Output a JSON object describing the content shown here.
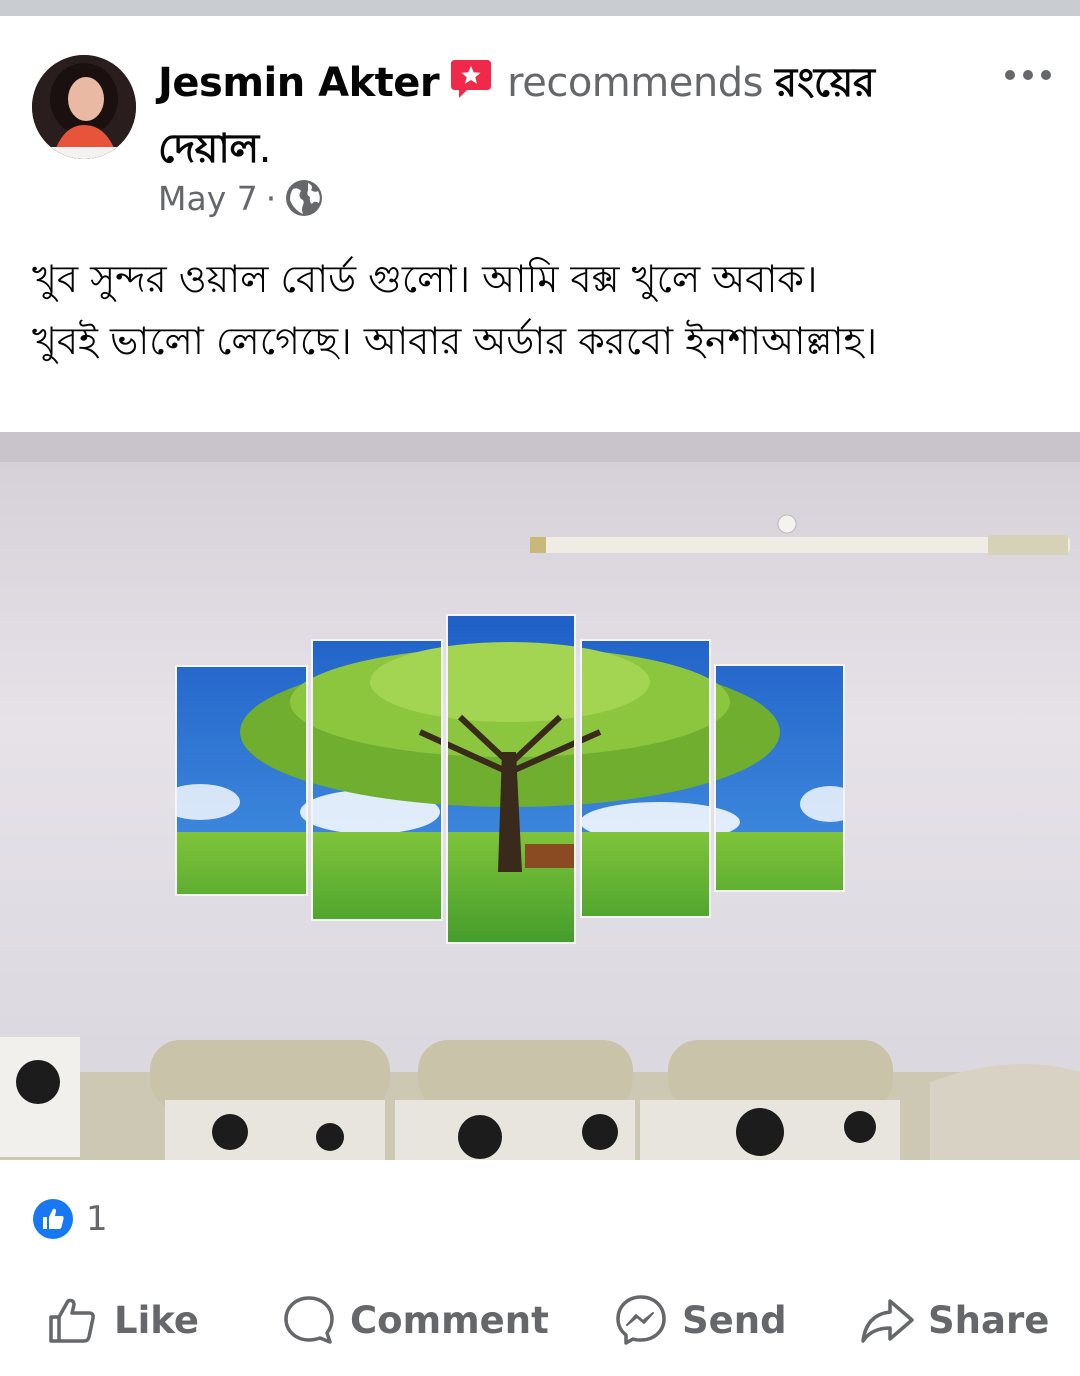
{
  "post": {
    "author": "Jesmin Akter",
    "recommends_word": "recommends",
    "page_name": "রংয়ের দেয়াল",
    "period": ".",
    "date": "May 7",
    "separator": "·",
    "text_line1": "খুব সুন্দর ওয়াল বোর্ড গুলো।  আমি বক্স খুলে অবাক।",
    "text_line2": "খুবই ভালো লেগেছে। আবার অর্ডার করবো ইনশাআল্লাহ।"
  },
  "icons": {
    "recommend": "recommend-star-icon",
    "audience": "globe-icon",
    "more": "more-options-icon",
    "reaction": "like-reaction-icon"
  },
  "reactions": {
    "count": "1"
  },
  "actions": {
    "like": "Like",
    "comment": "Comment",
    "send": "Send",
    "share": "Share"
  },
  "colors": {
    "recommend_red": "#f02849",
    "facebook_blue": "#1877f2",
    "secondary_text": "#65676b"
  }
}
